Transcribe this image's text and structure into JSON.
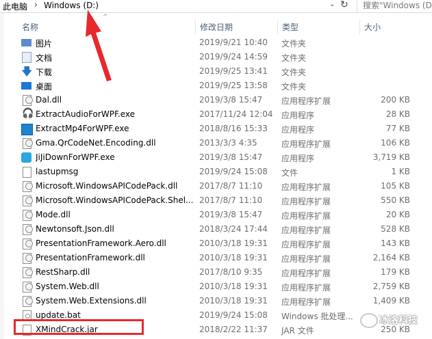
{
  "address_bar": {
    "root": "此电脑",
    "separator": "›",
    "current": "Windows (D:)",
    "dropdown_glyph": "⌄",
    "refresh_glyph": "↻",
    "search_placeholder": "搜索\"Windows (D:"
  },
  "columns": {
    "name": "名称",
    "date": "修改日期",
    "type": "类型",
    "size": "大小"
  },
  "sort_glyph": "^",
  "files": [
    {
      "name": "图片",
      "date": "2019/9/21 10:40",
      "type": "文件夹",
      "size": "",
      "icon": "pictures-folder-icon"
    },
    {
      "name": "文档",
      "date": "2019/9/24 14:59",
      "type": "文件夹",
      "size": "",
      "icon": "documents-folder-icon"
    },
    {
      "name": "下载",
      "date": "2019/9/25 13:41",
      "type": "文件夹",
      "size": "",
      "icon": "downloads-folder-icon"
    },
    {
      "name": "桌面",
      "date": "2019/9/25 13:58",
      "type": "文件夹",
      "size": "",
      "icon": "desktop-folder-icon"
    },
    {
      "name": "Dal.dll",
      "date": "2019/3/8 15:47",
      "type": "应用程序扩展",
      "size": "200 KB",
      "icon": "dll-file-icon"
    },
    {
      "name": "ExtractAudioForWPF.exe",
      "date": "2017/11/24 12:04",
      "type": "应用程序",
      "size": "28 KB",
      "icon": "headphones-icon"
    },
    {
      "name": "ExtractMp4ForWPF.exe",
      "date": "2018/8/16 15:33",
      "type": "应用程序",
      "size": "77 KB",
      "icon": "video-app-icon"
    },
    {
      "name": "Gma.QrCodeNet.Encoding.dll",
      "date": "2013/3/3 4:35",
      "type": "应用程序扩展",
      "size": "106 KB",
      "icon": "dll-file-icon"
    },
    {
      "name": "JiJiDownForWPF.exe",
      "date": "2019/3/8 15:47",
      "type": "应用程序",
      "size": "3,719 KB",
      "icon": "jijidown-app-icon"
    },
    {
      "name": "lastupmsg",
      "date": "2019/9/24 15:08",
      "type": "文件",
      "size": "1 KB",
      "icon": "blank-file-icon"
    },
    {
      "name": "Microsoft.WindowsAPICodePack.dll",
      "date": "2017/8/7 11:10",
      "type": "应用程序扩展",
      "size": "105 KB",
      "icon": "dll-file-icon"
    },
    {
      "name": "Microsoft.WindowsAPICodePack.Shel...",
      "date": "2017/8/7 11:10",
      "type": "应用程序扩展",
      "size": "550 KB",
      "icon": "dll-file-icon"
    },
    {
      "name": "Mode.dll",
      "date": "2019/3/8 15:47",
      "type": "应用程序扩展",
      "size": "20 KB",
      "icon": "dll-file-icon"
    },
    {
      "name": "Newtonsoft.Json.dll",
      "date": "2018/3/24 17:44",
      "type": "应用程序扩展",
      "size": "528 KB",
      "icon": "dll-file-icon"
    },
    {
      "name": "PresentationFramework.Aero.dll",
      "date": "2010/3/18 19:31",
      "type": "应用程序扩展",
      "size": "143 KB",
      "icon": "dll-file-icon"
    },
    {
      "name": "PresentationFramework.dll",
      "date": "2010/3/18 19:31",
      "type": "应用程序扩展",
      "size": "2,164 KB",
      "icon": "dll-file-icon"
    },
    {
      "name": "RestSharp.dll",
      "date": "2017/8/10 9:35",
      "type": "应用程序扩展",
      "size": "179 KB",
      "icon": "dll-file-icon"
    },
    {
      "name": "System.Web.dll",
      "date": "2010/3/18 19:31",
      "type": "应用程序扩展",
      "size": "2,759 KB",
      "icon": "dll-file-icon"
    },
    {
      "name": "System.Web.Extensions.dll",
      "date": "2010/3/18 19:31",
      "type": "应用程序扩展",
      "size": "1,409 KB",
      "icon": "dll-file-icon"
    },
    {
      "name": "update.bat",
      "date": "2019/9/24 15:08",
      "type": "Windows 批处理...",
      "size": "",
      "icon": "batch-file-icon"
    },
    {
      "name": "XMindCrack.jar",
      "date": "2018/2/22 11:37",
      "type": "JAR 文件",
      "size": "250 KB",
      "icon": "jar-file-icon"
    }
  ],
  "watermark": {
    "text": "冰洛科技"
  },
  "colors": {
    "annotation_red": "#e8282c",
    "header_text": "#4c607a",
    "folder_blue": "#1e78d4"
  }
}
